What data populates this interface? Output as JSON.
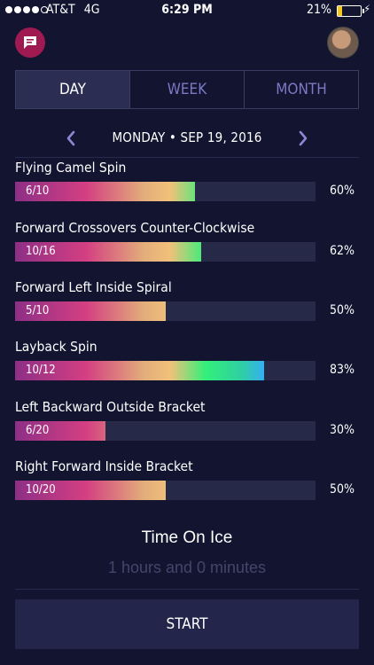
{
  "status_bar": {
    "carrier": "AT&T",
    "network": "4G",
    "time": "6:29 PM",
    "battery": "21%",
    "battery_level": 0.21,
    "signal_bars": 4
  },
  "header": {
    "chat_icon": "chat-bubble-icon",
    "avatar": "user-avatar"
  },
  "tabs": [
    {
      "label": "DAY",
      "active": true
    },
    {
      "label": "WEEK",
      "active": false
    },
    {
      "label": "MONTH",
      "active": false
    }
  ],
  "date_nav": {
    "date_label": "MONDAY • SEP 19, 2016",
    "prev_icon": "chevron-left-icon",
    "next_icon": "chevron-right-icon"
  },
  "skills": [
    {
      "name": "Flying Camel Spin",
      "fraction": "6/10",
      "percent": "60%",
      "progress": 0.6
    },
    {
      "name": "Forward Crossovers Counter-Clockwise",
      "fraction": "10/16",
      "percent": "62%",
      "progress": 0.62
    },
    {
      "name": "Forward Left Inside Spiral",
      "fraction": "5/10",
      "percent": "50%",
      "progress": 0.5
    },
    {
      "name": "Layback Spin",
      "fraction": "10/12",
      "percent": "83%",
      "progress": 0.83
    },
    {
      "name": "Left Backward Outside Bracket",
      "fraction": "6/20",
      "percent": "30%",
      "progress": 0.3
    },
    {
      "name": "Right Forward Inside Bracket",
      "fraction": "10/20",
      "percent": "50%",
      "progress": 0.5
    }
  ],
  "time_on_ice": {
    "title": "Time On Ice",
    "value": "1 hours and 0 minutes"
  },
  "start_button": "START",
  "colors": {
    "background": "#121430",
    "active_tab": "#2b2e52",
    "inactive_tab_text": "#7c79c5",
    "chat_button": "#a01a52",
    "track": "#262948"
  }
}
